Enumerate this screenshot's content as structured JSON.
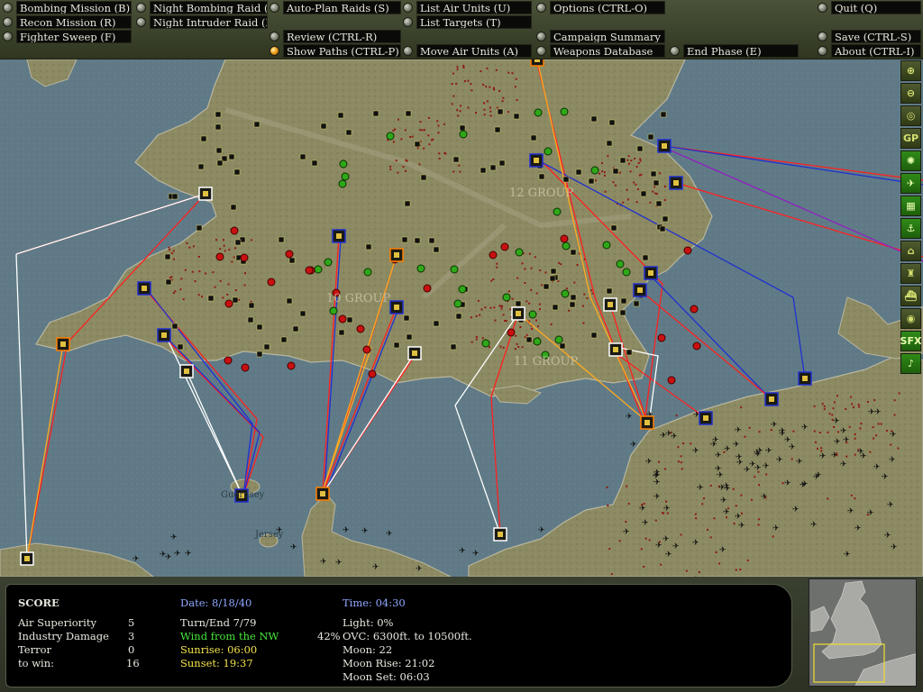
{
  "menu": {
    "bombing_mission": "Bombing Mission (B)",
    "recon_mission": "Recon Mission (R)",
    "fighter_sweep": "Fighter Sweep (F)",
    "night_bombing_raid": "Night Bombing Raid (N)",
    "night_intruder_raid": "Night Intruder Raid (I)",
    "auto_plan_raids": "Auto-Plan Raids (S)",
    "review": "Review (CTRL-R)",
    "show_paths": "Show Paths (CTRL-P)",
    "list_air_units": "List Air Units (U)",
    "list_targets": "List Targets (T)",
    "move_air_units": "Move Air Units (A)",
    "options": "Options (CTRL-O)",
    "campaign_summary": "Campaign Summary",
    "weapons_database": "Weapons Database",
    "end_phase": "End Phase (E)",
    "quit": "Quit (Q)",
    "save": "Save (CTRL-S)",
    "about": "About (CTRL-I)"
  },
  "map": {
    "labels": {
      "group12": "12 GROUP",
      "group10": "10 GROUP",
      "group11": "11 GROUP",
      "guernsey": "Guernsey",
      "jersey": "Jersey"
    },
    "colors": {
      "land": "#8c8a62",
      "sea": "#5f7a86",
      "red_path": "#ff2020",
      "blue_path": "#2030d0",
      "white_path": "#ffffff",
      "orange_path": "#ffaa20",
      "target_dot": "#8e1a12"
    }
  },
  "toolbar": {
    "zoom_in": "zoom-in-icon",
    "zoom_out": "zoom-out-icon",
    "center": "crosshair-icon",
    "gp": "GP",
    "radar": "radar-icon",
    "aircraft": "aircraft-icon",
    "factory": "factory-icon",
    "anchor": "anchor-icon",
    "airfield": "airfield-icon",
    "city": "city-icon",
    "ship": "ship-icon",
    "radio": "radio-icon",
    "sfx": "SFX",
    "music": "music-icon"
  },
  "score": {
    "title": "SCORE",
    "air_superiority_label": "Air Superiority",
    "air_superiority_value": "5",
    "industry_damage_label": "Industry Damage",
    "industry_damage_value": "3",
    "terror_label": "Terror",
    "terror_value": "0",
    "to_win_label": "to win:",
    "to_win_value": "16"
  },
  "status": {
    "date": "Date: 8/18/40",
    "turn": "Turn/End  7/79",
    "wind": "Wind from the NW",
    "sunrise": "Sunrise: 06:00",
    "sunset": "Sunset: 19:37",
    "time": "Time: 04:30",
    "light": "Light: 0%",
    "cloud_pct": "42%",
    "cloud": "OVC: 6300ft. to 10500ft.",
    "moon": "Moon: 22",
    "moon_rise": "Moon Rise: 21:02",
    "moon_set": "Moon Set: 06:03"
  }
}
